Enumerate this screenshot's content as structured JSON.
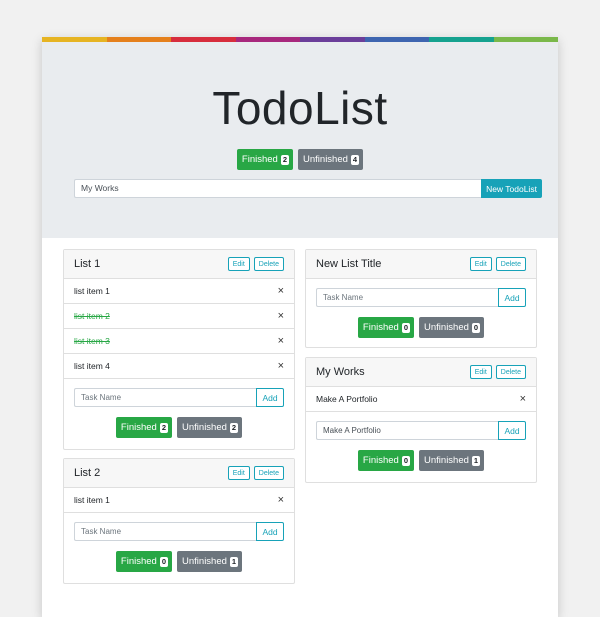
{
  "colors": {
    "rainbow": [
      "#e6b423",
      "#e5801c",
      "#d72d3d",
      "#a8287d",
      "#6b3e9a",
      "#3e65b0",
      "#16a28f",
      "#7ab84a"
    ],
    "finished": "#28a745",
    "unfinished": "#6c757d",
    "accent": "#17a2b8"
  },
  "header": {
    "title": "TodoList",
    "finished_label": "Finished",
    "finished_count": "2",
    "unfinished_label": "Unfinished",
    "unfinished_count": "4",
    "list_name_value": "My Works",
    "new_list_label": "New TodoList"
  },
  "lists": [
    {
      "title": "List 1",
      "edit_label": "Edit",
      "delete_label": "Delete",
      "items": [
        {
          "text": "list item 1",
          "done": false
        },
        {
          "text": "list item 2",
          "done": true
        },
        {
          "text": "list item 3",
          "done": true
        },
        {
          "text": "list item 4",
          "done": false
        }
      ],
      "input_placeholder": "Task Name",
      "input_value": "",
      "add_label": "Add",
      "finished_label": "Finished",
      "finished_count": "2",
      "unfinished_label": "Unfinished",
      "unfinished_count": "2"
    },
    {
      "title": "List 2",
      "edit_label": "Edit",
      "delete_label": "Delete",
      "items": [
        {
          "text": "list item 1",
          "done": false
        }
      ],
      "input_placeholder": "Task Name",
      "input_value": "",
      "add_label": "Add",
      "finished_label": "Finished",
      "finished_count": "0",
      "unfinished_label": "Unfinished",
      "unfinished_count": "1"
    },
    {
      "title": "New List Title",
      "edit_label": "Edit",
      "delete_label": "Delete",
      "items": [],
      "input_placeholder": "Task Name",
      "input_value": "",
      "add_label": "Add",
      "finished_label": "Finished",
      "finished_count": "0",
      "unfinished_label": "Unfinished",
      "unfinished_count": "0"
    },
    {
      "title": "My Works",
      "edit_label": "Edit",
      "delete_label": "Delete",
      "items": [
        {
          "text": "Make A Portfolio",
          "done": false
        }
      ],
      "input_placeholder": "Task Name",
      "input_value": "Make A Portfolio",
      "add_label": "Add",
      "finished_label": "Finished",
      "finished_count": "0",
      "unfinished_label": "Unfinished",
      "unfinished_count": "1"
    }
  ],
  "icons": {
    "remove": "close-icon",
    "remove_glyph": "×"
  }
}
